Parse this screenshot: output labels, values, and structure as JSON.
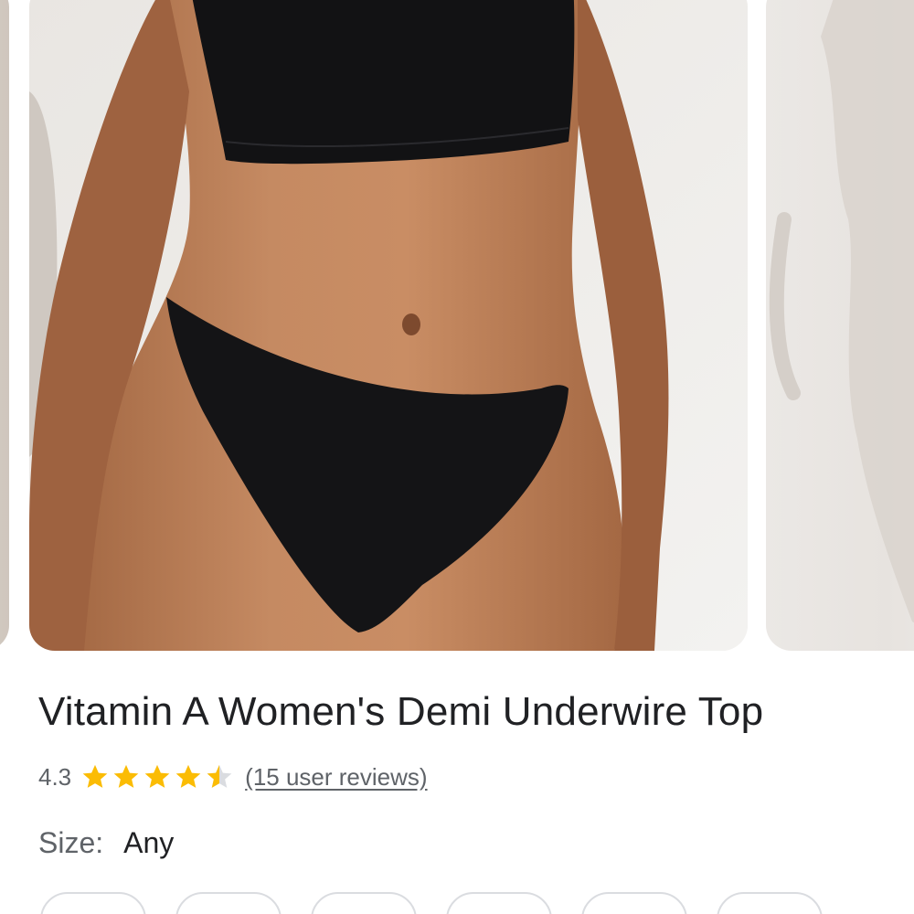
{
  "product": {
    "title": "Vitamin A Women's Demi Underwire Top",
    "rating": {
      "value": "4.3",
      "stars": 4.3,
      "max_stars": 5,
      "star_color": "#fbbc04",
      "empty_star_color": "#dadce0",
      "reviews_text": "(15 user reviews)"
    },
    "size": {
      "label": "Size:",
      "value": "Any"
    }
  },
  "colors": {
    "text_primary": "#202124",
    "text_secondary": "#5f6368",
    "chip_border": "#dadce0"
  },
  "icons": {
    "star": "star-icon",
    "half_star": "half-star-icon"
  }
}
